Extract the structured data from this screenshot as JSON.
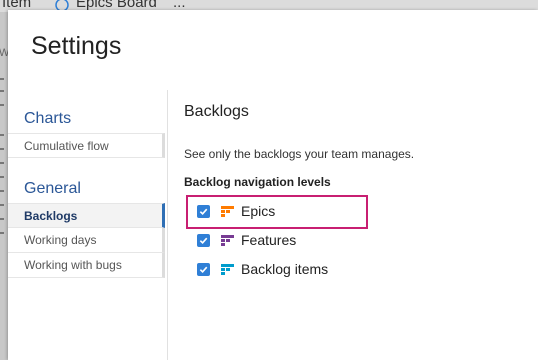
{
  "background": {
    "item_a": "Item",
    "item_b": "Epics Board",
    "item_c": "...",
    "side_letter": "W"
  },
  "dialog": {
    "title": "Settings"
  },
  "nav": {
    "groups": [
      {
        "title": "Charts",
        "items": [
          {
            "label": "Cumulative flow",
            "selected": false
          }
        ]
      },
      {
        "title": "General",
        "items": [
          {
            "label": "Backlogs",
            "selected": true
          },
          {
            "label": "Working days",
            "selected": false
          },
          {
            "label": "Working with bugs",
            "selected": false
          }
        ]
      }
    ]
  },
  "content": {
    "title": "Backlogs",
    "description": "See only the backlogs your team manages.",
    "subtitle": "Backlog navigation levels",
    "levels": [
      {
        "label": "Epics",
        "checked": true,
        "icon": "epic-icon",
        "color": "#ff7b00"
      },
      {
        "label": "Features",
        "checked": true,
        "icon": "feature-icon",
        "color": "#773b93"
      },
      {
        "label": "Backlog items",
        "checked": true,
        "icon": "backlog-item-icon",
        "color": "#009ccc"
      }
    ]
  },
  "colors": {
    "accent": "#2f7fd6",
    "nav_selected": "#2f6fb5",
    "highlight": "#c81f72",
    "group_title": "#2b5797"
  }
}
